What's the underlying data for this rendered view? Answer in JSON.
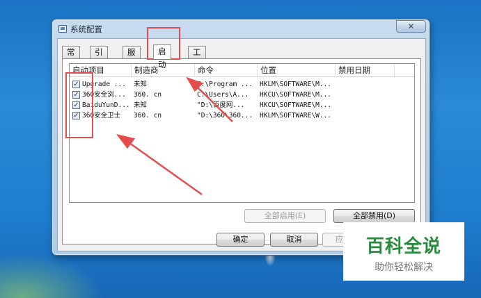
{
  "window": {
    "title": "系统配置",
    "close_glyph": "✕"
  },
  "tabs": [
    "常规",
    "引导",
    "服务",
    "启动",
    "工具"
  ],
  "active_tab": "启动",
  "columns": [
    "启动项目",
    "制造商",
    "命令",
    "位置",
    "禁用日期"
  ],
  "rows": [
    {
      "checked": true,
      "item": "Upgrade ...",
      "maker": "未知",
      "command": "C:\\Program ...",
      "location": "HKLM\\SOFTWARE\\M..."
    },
    {
      "checked": true,
      "item": "360安全浏...",
      "maker": "360. cn",
      "command": "C:\\Users\\A...",
      "location": "HKCU\\SOFTWARE\\M..."
    },
    {
      "checked": true,
      "item": "BaiduYunD...",
      "maker": "未知",
      "command": "\"D:\\百度网...",
      "location": "HKCU\\SOFTWARE\\M..."
    },
    {
      "checked": true,
      "item": "360安全卫士",
      "maker": "360. cn",
      "command": "\"D:\\360\\360...",
      "location": "HKLM\\SOFTWARE\\W..."
    }
  ],
  "panel_buttons": {
    "enable_all": "全部启用(E)",
    "disable_all": "全部禁用(D)"
  },
  "dialog_buttons": {
    "ok": "确定",
    "cancel": "取消",
    "apply": "应用"
  },
  "watermark": {
    "main": "百科全说",
    "sub": "助你轻松解决"
  },
  "colors": {
    "annotation_red": "#e54d4d",
    "watermark_green": "#2a8a3e"
  }
}
